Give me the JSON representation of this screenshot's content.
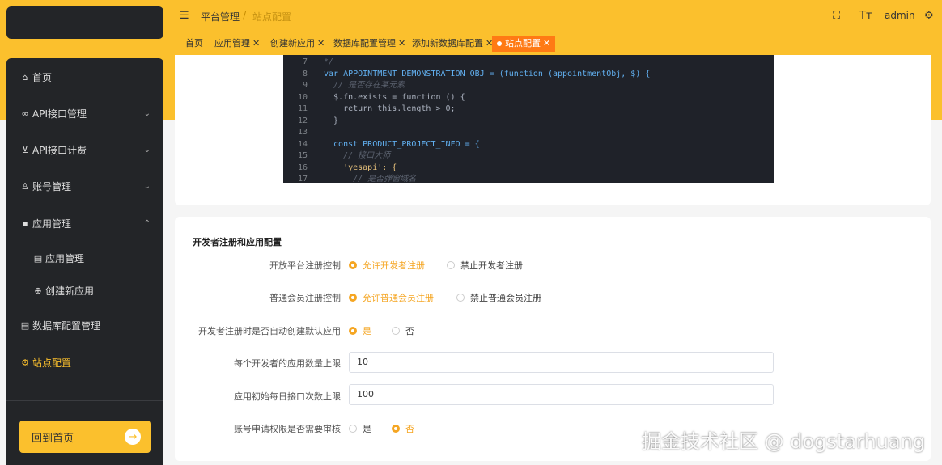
{
  "header": {
    "breadcrumb": [
      "平台管理",
      "/",
      "站点配置"
    ],
    "user": "admin",
    "icons": [
      "fullscreen-icon",
      "font-size-icon",
      "settings-icon"
    ]
  },
  "tabs": [
    {
      "label": "首页",
      "closable": false,
      "active": false
    },
    {
      "label": "应用管理",
      "closable": true,
      "active": false
    },
    {
      "label": "创建新应用",
      "closable": true,
      "active": false
    },
    {
      "label": "数据库配置管理",
      "closable": true,
      "active": false
    },
    {
      "label": "添加新数据库配置",
      "closable": true,
      "active": false
    },
    {
      "label": "站点配置",
      "closable": true,
      "active": true
    }
  ],
  "sidebar": {
    "items": [
      {
        "label": "首页",
        "icon": "home-icon"
      },
      {
        "label": "API接口管理",
        "icon": "link-icon",
        "caret": "down"
      },
      {
        "label": "API接口计费",
        "icon": "cart-icon",
        "caret": "down"
      },
      {
        "label": "账号管理",
        "icon": "user-icon",
        "caret": "down"
      },
      {
        "label": "应用管理",
        "icon": "apps-icon",
        "caret": "up"
      },
      {
        "label": "应用管理",
        "icon": "clipboard-icon",
        "sub": true
      },
      {
        "label": "创建新应用",
        "icon": "plus-circle-icon",
        "sub": true
      },
      {
        "label": "数据库配置管理",
        "icon": "clipboard-icon"
      },
      {
        "label": "站点配置",
        "icon": "gear-icon",
        "active": true
      }
    ],
    "back_button": "回到首页"
  },
  "code": {
    "lines": [
      {
        "n": "7",
        "text": "*/"
      },
      {
        "n": "8",
        "text": "var APPOINTMENT_DEMONSTRATION_OBJ = (function (appointmentObj, $) {"
      },
      {
        "n": "9",
        "text": "  // 是否存在某元素"
      },
      {
        "n": "10",
        "text": "  $.fn.exists = function () {"
      },
      {
        "n": "11",
        "text": "    return this.length > 0;"
      },
      {
        "n": "12",
        "text": "  }"
      },
      {
        "n": "13",
        "text": ""
      },
      {
        "n": "14",
        "text": "  const PRODUCT_PROJECT_INFO = {"
      },
      {
        "n": "15",
        "text": "    // 接口大师"
      },
      {
        "n": "16",
        "text": "    'yesapi': {"
      },
      {
        "n": "17",
        "text": "      // 是否弹窗域名"
      }
    ]
  },
  "form": {
    "title": "开发者注册和应用配置",
    "rows": [
      {
        "label": "开放平台注册控制",
        "options": [
          "允许开发者注册",
          "禁止开发者注册"
        ],
        "selected": 0
      },
      {
        "label": "普通会员注册控制",
        "options": [
          "允许普通会员注册",
          "禁止普通会员注册"
        ],
        "selected": 0
      },
      {
        "label": "开发者注册时是否自动创建默认应用",
        "options": [
          "是",
          "否"
        ],
        "selected": 0
      },
      {
        "label": "每个开发者的应用数量上限",
        "value": "10"
      },
      {
        "label": "应用初始每日接口次数上限",
        "value": "100"
      },
      {
        "label": "账号申请权限是否需要审核",
        "options": [
          "是",
          "否"
        ],
        "selected": 1
      }
    ]
  },
  "watermark": "掘金技术社区 @ dogstarhuang",
  "colors": {
    "accent": "#fbc02d",
    "active_tab": "#ff7a14",
    "radio_checked": "#f5a623",
    "sidebar": "#232528"
  }
}
